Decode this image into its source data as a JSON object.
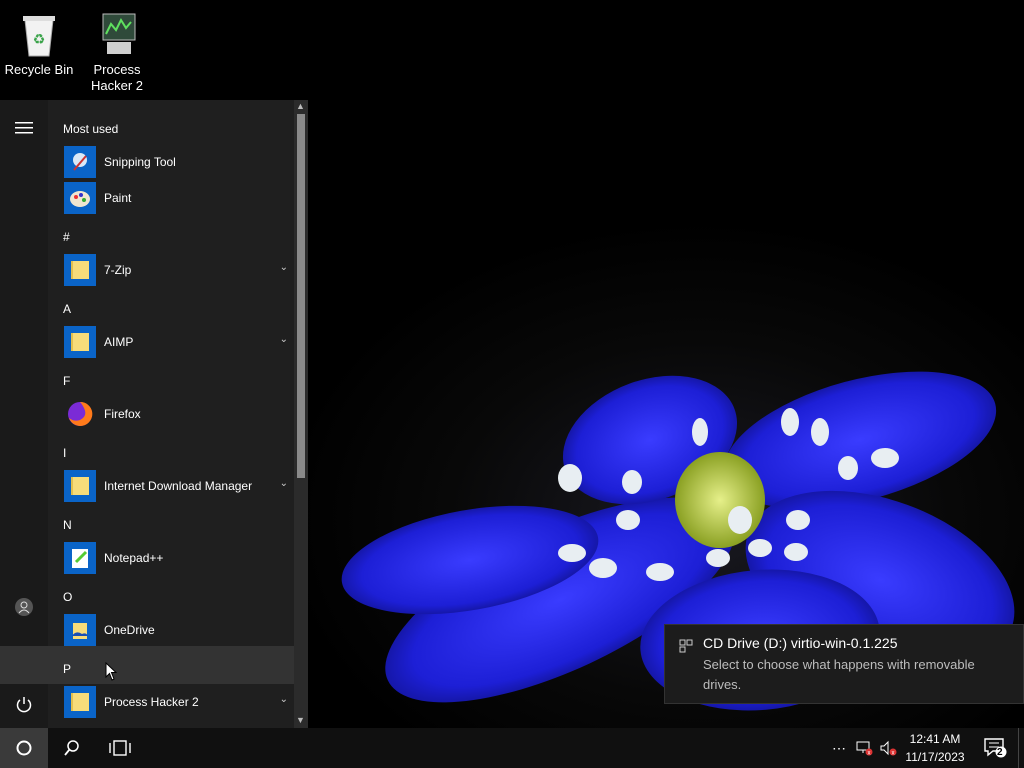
{
  "desktop": {
    "icons": [
      {
        "label": "Recycle Bin"
      },
      {
        "label": "Process Hacker 2"
      }
    ]
  },
  "start_menu": {
    "most_used_header": "Most used",
    "most_used": [
      {
        "label": "Snipping Tool",
        "icon": "snipping-tool-icon"
      },
      {
        "label": "Paint",
        "icon": "paint-icon"
      }
    ],
    "groups": [
      {
        "letter": "#",
        "apps": [
          {
            "label": "7-Zip",
            "icon": "folder-icon",
            "expandable": true
          }
        ]
      },
      {
        "letter": "A",
        "apps": [
          {
            "label": "AIMP",
            "icon": "folder-icon",
            "expandable": true
          }
        ]
      },
      {
        "letter": "F",
        "apps": [
          {
            "label": "Firefox",
            "icon": "firefox-icon",
            "expandable": false
          }
        ]
      },
      {
        "letter": "I",
        "apps": [
          {
            "label": "Internet Download Manager",
            "icon": "folder-icon",
            "expandable": true
          }
        ]
      },
      {
        "letter": "N",
        "apps": [
          {
            "label": "Notepad++",
            "icon": "notepadpp-icon",
            "expandable": false
          }
        ]
      },
      {
        "letter": "O",
        "apps": [
          {
            "label": "OneDrive",
            "icon": "onedrive-icon",
            "expandable": false
          }
        ]
      },
      {
        "letter": "P",
        "apps": [
          {
            "label": "Process Hacker 2",
            "icon": "folder-icon",
            "expandable": true
          }
        ]
      }
    ],
    "rail_icons": [
      "hamburger-icon",
      "user-icon",
      "settings-icon",
      "power-icon"
    ]
  },
  "toast": {
    "title": "CD Drive (D:) virtio-win-0.1.225",
    "body": "Select to choose what happens with removable drives."
  },
  "taskbar": {
    "time": "12:41 AM",
    "date": "11/17/2023",
    "notification_count": "2"
  },
  "colors": {
    "taskbar": "#101010",
    "start_bg": "#1f1f1f",
    "tile_blue": "#0a64c8",
    "folder_yellow": "#f7dc7a"
  }
}
